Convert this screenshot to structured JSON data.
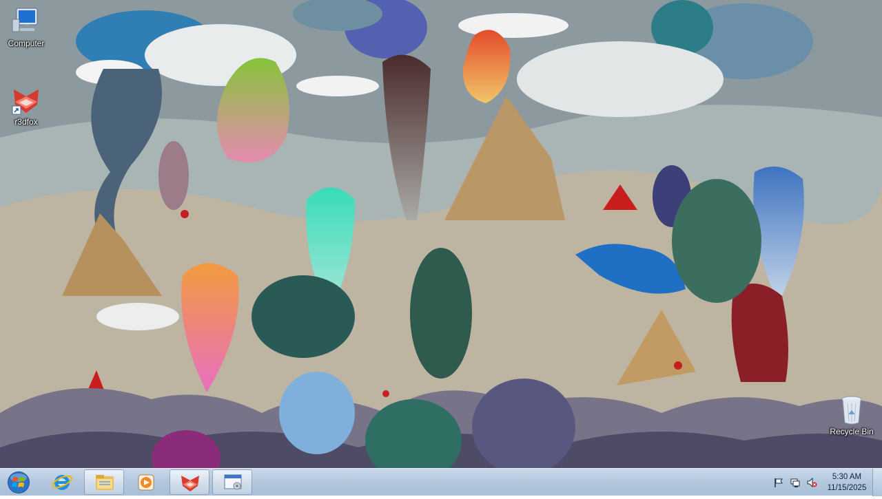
{
  "desktop": {
    "icons": [
      {
        "name": "computer-icon",
        "label": "Computer"
      },
      {
        "name": "r3dfox-icon",
        "label": "r3dfox"
      },
      {
        "name": "recycle-bin-icon",
        "label": "Recycle Bin"
      }
    ]
  },
  "taskbar": {
    "start_label": "Start",
    "pinned": [
      {
        "name": "internet-explorer-icon",
        "active": false
      },
      {
        "name": "file-explorer-icon",
        "active": true
      },
      {
        "name": "media-player-icon",
        "active": false
      },
      {
        "name": "r3dfox-taskbar-icon",
        "active": true
      },
      {
        "name": "window-app-icon",
        "active": true
      }
    ],
    "tray": {
      "icons": [
        "flag-icon",
        "network-icon",
        "volume-muted-icon"
      ],
      "time": "5:30 AM",
      "date": "11/15/2025"
    }
  },
  "colors": {
    "taskbar": "#b4c8de",
    "label_text": "#ffffff"
  }
}
